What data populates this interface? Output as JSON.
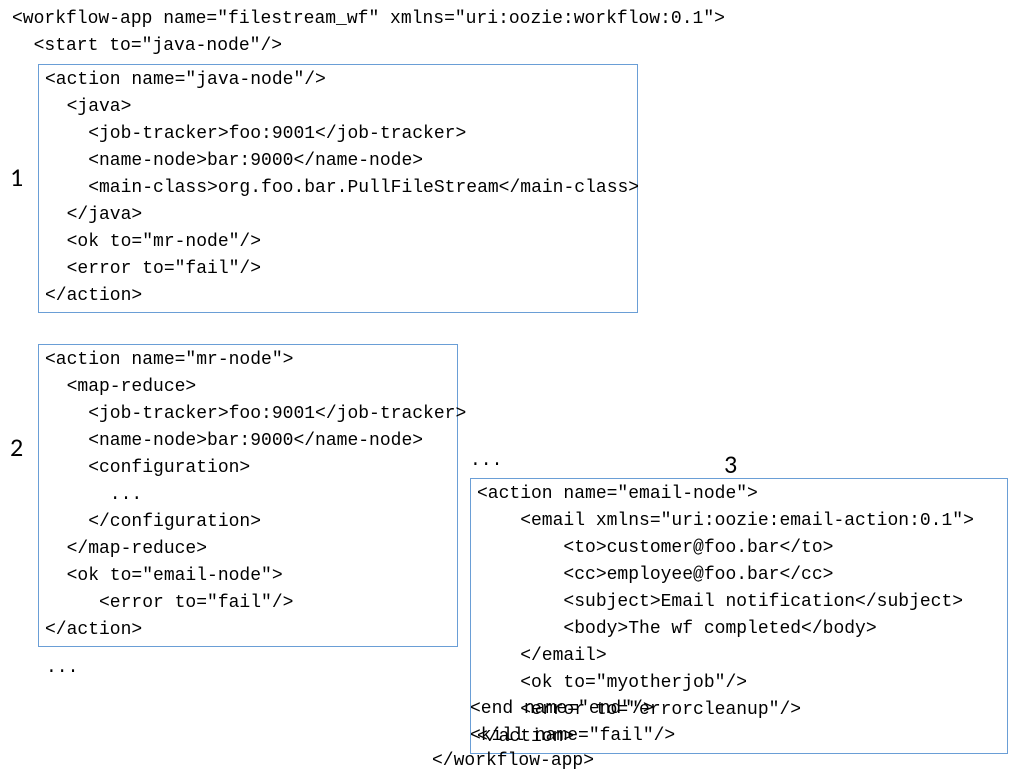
{
  "header": {
    "l1": "<workflow-app name=\"filestream_wf\" xmlns=\"uri:oozie:workflow:0.1\">",
    "l2": "  <start to=\"java-node\"/>"
  },
  "labels": {
    "n1": "1",
    "n2": "2",
    "n3": "3"
  },
  "box1": {
    "l1": "<action name=\"java-node\"/>",
    "l2": "  <java>",
    "l3": "    <job-tracker>foo:9001</job-tracker>",
    "l4": "    <name-node>bar:9000</name-node>",
    "l5": "    <main-class>org.foo.bar.PullFileStream</main-class>",
    "l6": "  </java>",
    "l7": "  <ok to=\"mr-node\"/>",
    "l8": "  <error to=\"fail\"/>",
    "l9": "</action>"
  },
  "box2": {
    "l1": "<action name=\"mr-node\">",
    "l2": "  <map-reduce>",
    "l3": "    <job-tracker>foo:9001</job-tracker>",
    "l4": "    <name-node>bar:9000</name-node>",
    "l5": "    <configuration>",
    "l6": "      ...",
    "l7": "    </configuration>",
    "l8": "  </map-reduce>",
    "l9": "  <ok to=\"email-node\">",
    "l10": "     <error to=\"fail\"/>",
    "l11": "</action>"
  },
  "dots2b": "...",
  "dots3": "...",
  "box3": {
    "l1": "<action name=\"email-node\">",
    "l2": "    <email xmlns=\"uri:oozie:email-action:0.1\">",
    "l3": "        <to>customer@foo.bar</to>",
    "l4": "        <cc>employee@foo.bar</cc>",
    "l5": "        <subject>Email notification</subject>",
    "l6": "        <body>The wf completed</body>",
    "l7": "    </email>",
    "l8": "    <ok to=\"myotherjob\"/>",
    "l9": "    <error to=\"errorcleanup\"/>",
    "l10": "</action>"
  },
  "footer": {
    "l1": "<end name=\"end\"/>",
    "l2": "<kill name=\"fail\"/>"
  },
  "footer_close": "</workflow-app>"
}
